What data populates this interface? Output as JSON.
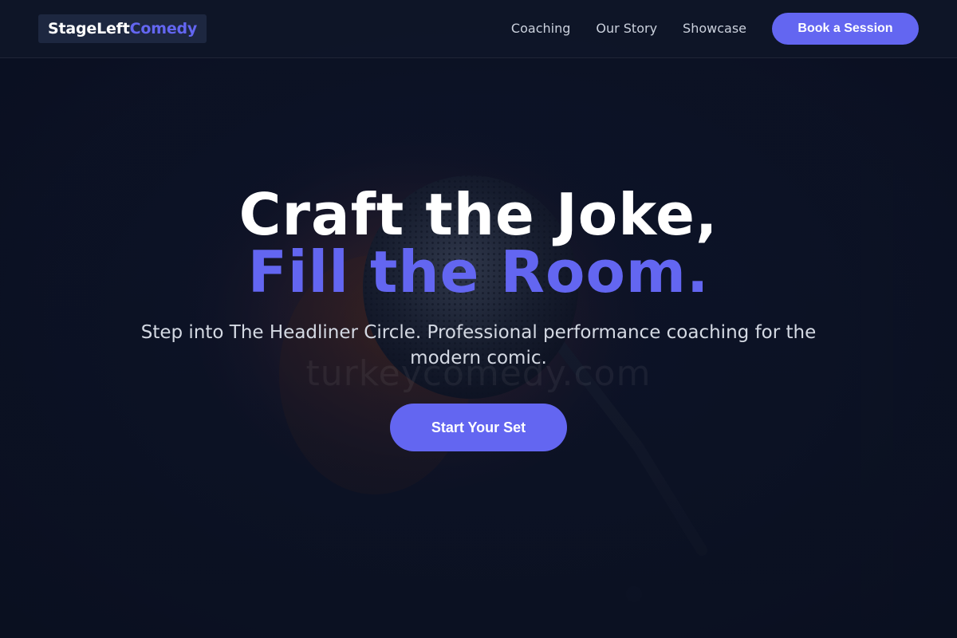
{
  "header": {
    "logo_part1": "StageLeft",
    "logo_part2": "Comedy",
    "nav": [
      {
        "label": "Coaching"
      },
      {
        "label": "Our Story"
      },
      {
        "label": "Showcase"
      }
    ],
    "cta_label": "Book a Session"
  },
  "hero": {
    "headline_line1": "Craft the Joke,",
    "headline_line2": "Fill the Room.",
    "subtitle": "Step into The Headliner Circle. Professional performance coaching for the modern comic.",
    "cta_label": "Start Your Set",
    "watermark": "turkeycomedy.com",
    "background_image": "microphone-photo"
  },
  "colors": {
    "accent": "#6366f1",
    "background": "#0c1226",
    "header_bg": "#0f1628",
    "text_primary": "#ffffff",
    "text_muted": "#cbd1dd"
  }
}
